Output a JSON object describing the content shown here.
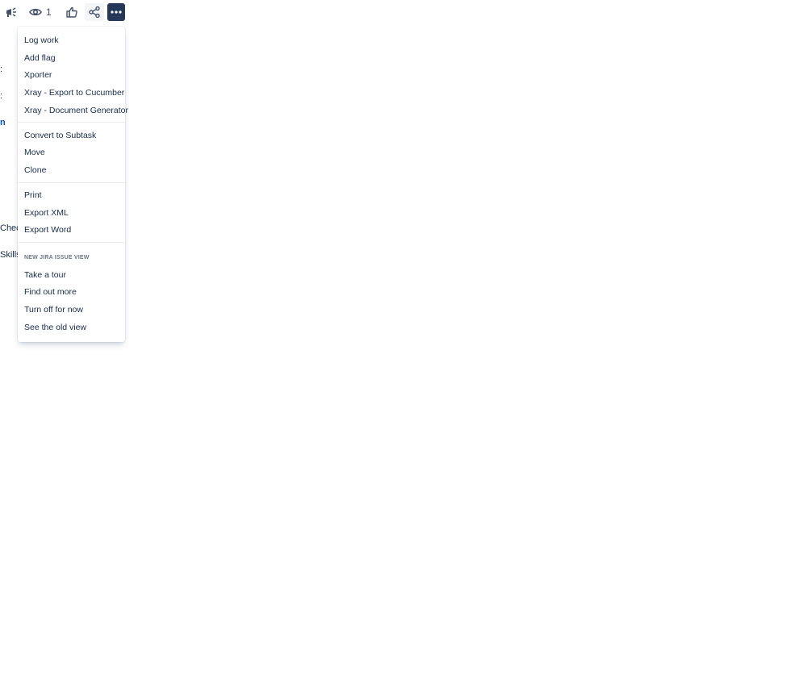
{
  "toolbar": {
    "watch_count": "1",
    "icons": [
      "megaphone-icon",
      "eye-icon",
      "thumbs-up-icon",
      "share-icon",
      "more-icon"
    ],
    "more_button_bg": "#253858"
  },
  "background": {
    "label_check": "Check",
    "label_skills": "Skills"
  },
  "menu": {
    "group1": [
      "Log work",
      "Add flag",
      "Xporter",
      "Xray - Export to Cucumber",
      "Xray - Document Generator"
    ],
    "group2": [
      "Convert to Subtask",
      "Move",
      "Clone"
    ],
    "group3": [
      "Print",
      "Export XML",
      "Export Word"
    ],
    "section_heading": "NEW JIRA ISSUE VIEW",
    "group4": [
      "Take a tour",
      "Find out more",
      "Turn off for now",
      "See the old view"
    ]
  }
}
